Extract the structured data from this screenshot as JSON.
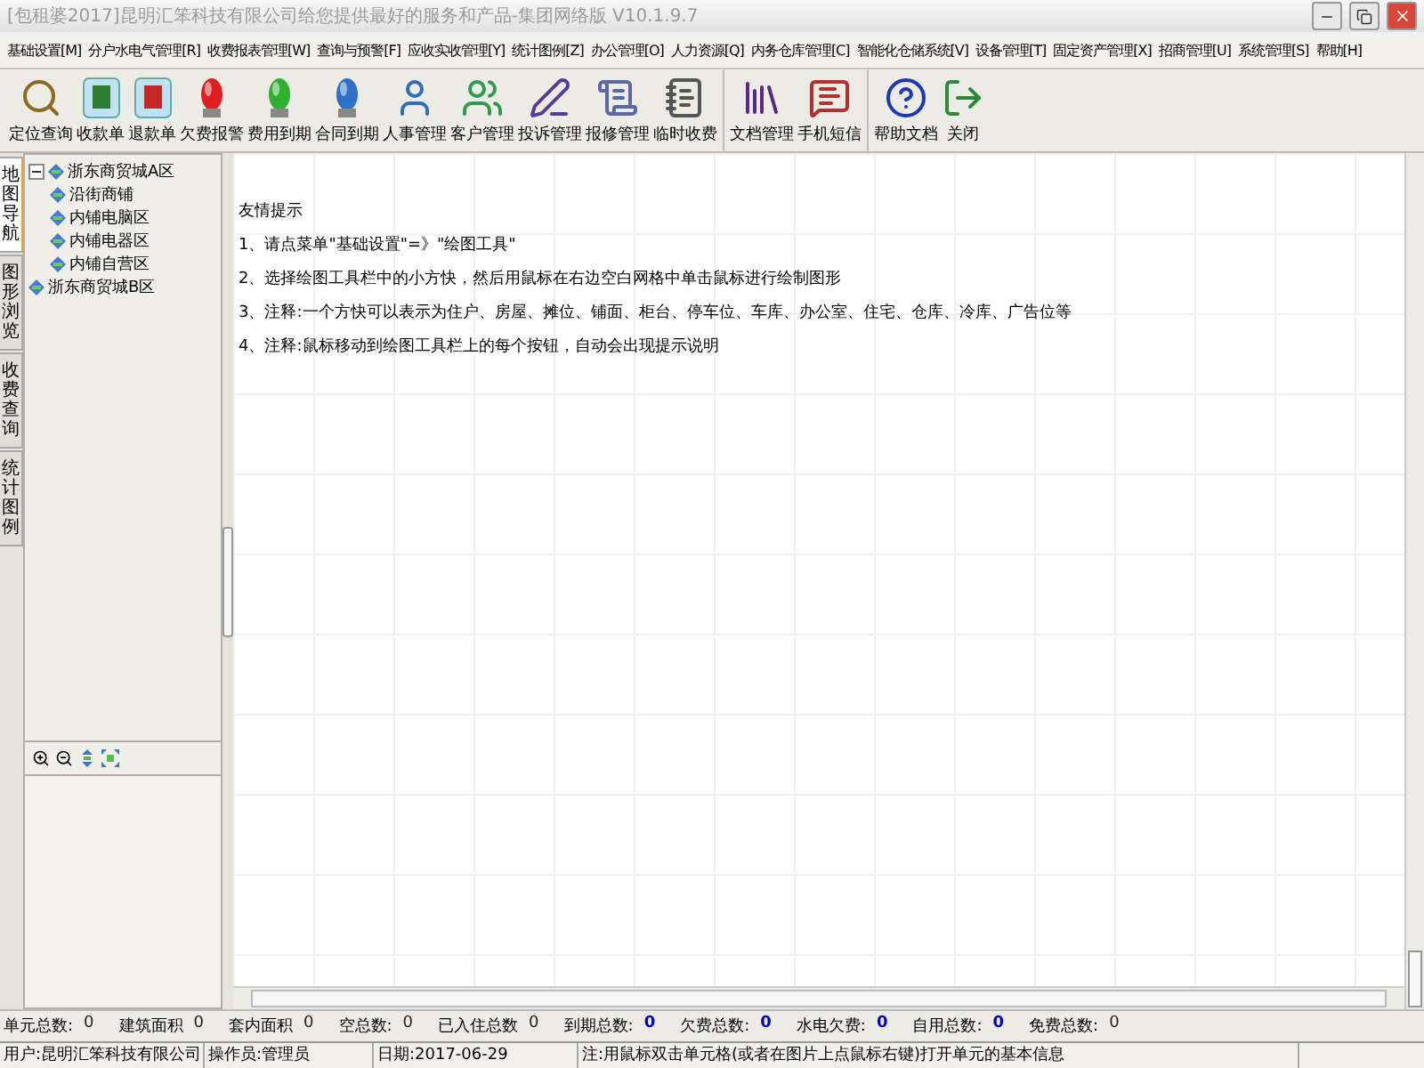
{
  "window": {
    "title": "[包租婆2017]昆明汇笨科技有限公司给您提供最好的服务和产品-集团网络版 V10.1.9.7"
  },
  "menu": [
    "基础设置[M]",
    "分户水电气管理[R]",
    "收费报表管理[W]",
    "查询与预警[F]",
    "应收实收管理[Y]",
    "统计图例[Z]",
    "办公管理[O]",
    "人力资源[Q]",
    "内务仓库管理[C]",
    "智能化仓储系统[V]",
    "设备管理[T]",
    "固定资产管理[X]",
    "招商管理[U]",
    "系统管理[S]",
    "帮助[H]"
  ],
  "toolbar": {
    "groups": [
      {
        "buttons": [
          {
            "label": "定位查询",
            "kind": "search"
          },
          {
            "label": "收款单",
            "kind": "receipt"
          },
          {
            "label": "退款单",
            "kind": "refund"
          },
          {
            "label": "欠费报警",
            "kind": "lamp-red"
          },
          {
            "label": "费用到期",
            "kind": "lamp-green"
          },
          {
            "label": "合同到期",
            "kind": "lamp-blue"
          },
          {
            "label": "人事管理",
            "kind": "person"
          },
          {
            "label": "客户管理",
            "kind": "people"
          },
          {
            "label": "投诉管理",
            "kind": "pen"
          },
          {
            "label": "报修管理",
            "kind": "scroll"
          },
          {
            "label": "临时收费",
            "kind": "notes"
          }
        ]
      },
      {
        "buttons": [
          {
            "label": "文档管理",
            "kind": "books"
          },
          {
            "label": "手机短信",
            "kind": "message"
          }
        ]
      },
      {
        "buttons": [
          {
            "label": "帮助文档",
            "kind": "help"
          },
          {
            "label": "关闭",
            "kind": "exit"
          }
        ]
      }
    ]
  },
  "side_tabs": [
    {
      "label": "地图导航",
      "selected": true
    },
    {
      "label": "图形浏览",
      "selected": false
    },
    {
      "label": "收费查询",
      "selected": false
    },
    {
      "label": "统计图例",
      "selected": false
    }
  ],
  "tree": [
    {
      "label": "浙东商贸城A区",
      "expanded": true,
      "children": [
        {
          "label": "沿街商铺"
        },
        {
          "label": "内铺电脑区"
        },
        {
          "label": "内铺电器区"
        },
        {
          "label": "内铺自营区"
        }
      ]
    },
    {
      "label": "浙东商贸城B区"
    }
  ],
  "tips": {
    "title": "友情提示",
    "lines": [
      "1、请点菜单\"基础设置\"=》\"绘图工具\"",
      "2、选择绘图工具栏中的小方快，然后用鼠标在右边空白网格中单击鼠标进行绘制图形",
      "3、注释:一个方快可以表示为住户、房屋、摊位、铺面、柜台、停车位、车库、办公室、住宅、仓库、冷库、广告位等",
      "4、注释:鼠标移动到绘图工具栏上的每个按钮，自动会出现提示说明"
    ]
  },
  "stats": [
    {
      "label": "单元总数:",
      "value": "0",
      "highlight": false
    },
    {
      "label": "建筑面积",
      "value": "0",
      "highlight": false
    },
    {
      "label": "套内面积",
      "value": "0",
      "highlight": false
    },
    {
      "label": "空总数:",
      "value": "0",
      "highlight": false
    },
    {
      "label": "已入住总数",
      "value": "0",
      "highlight": false
    },
    {
      "label": "到期总数:",
      "value": "0",
      "highlight": true
    },
    {
      "label": "欠费总数:",
      "value": "0",
      "highlight": true
    },
    {
      "label": "水电欠费:",
      "value": "0",
      "highlight": true
    },
    {
      "label": "自用总数:",
      "value": "0",
      "highlight": true
    },
    {
      "label": "免费总数:",
      "value": "0",
      "highlight": false
    }
  ],
  "status_bar": [
    "用户:昆明汇笨科技有限公司",
    "操作员:管理员",
    "日期:2017-06-29",
    "注:用鼠标双击单元格(或者在图片上点鼠标右键)打开单元的基本信息"
  ]
}
